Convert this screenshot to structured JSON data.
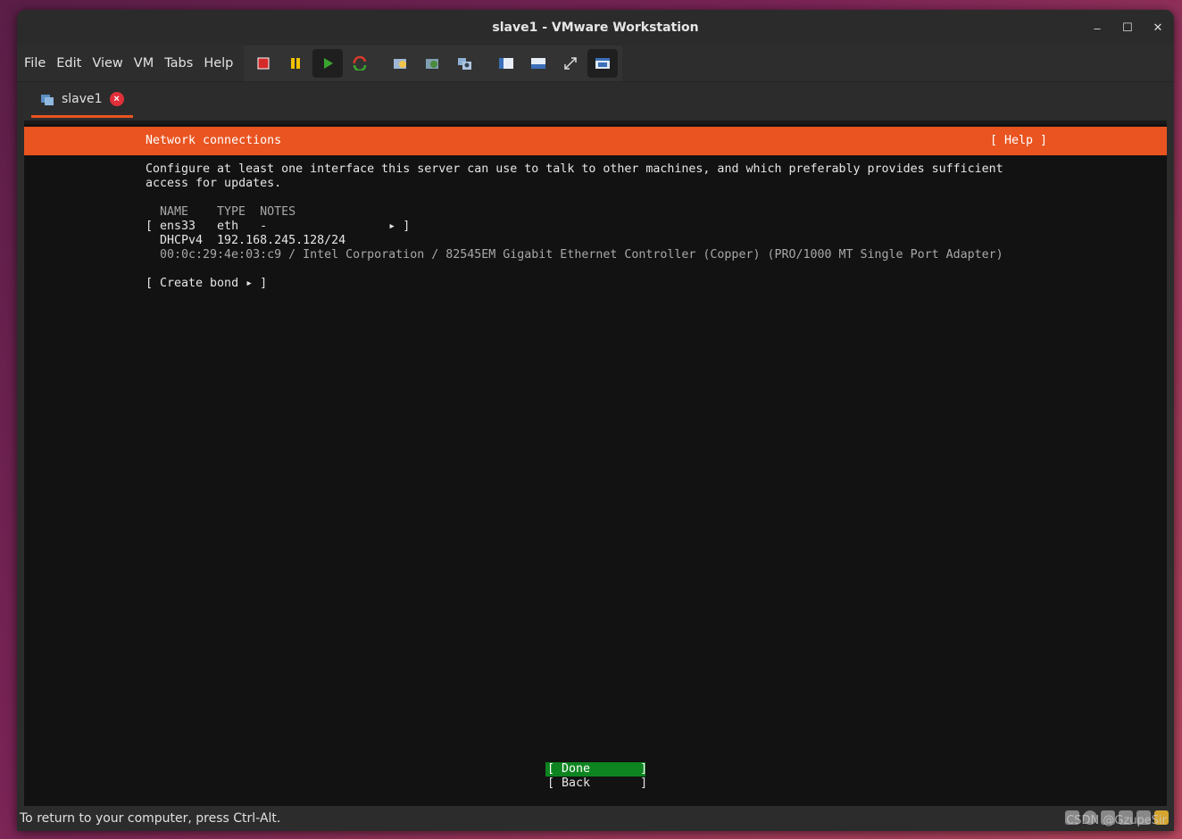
{
  "window": {
    "title": "slave1 - VMware Workstation",
    "controls": [
      "minimize",
      "maximize",
      "close"
    ]
  },
  "menubar": {
    "items": [
      "File",
      "Edit",
      "View",
      "VM",
      "Tabs",
      "Help"
    ]
  },
  "toolbar": {
    "buttons": [
      "power-off-icon",
      "suspend-icon",
      "power-on-icon",
      "reset-icon",
      "snapshot-icon",
      "revert-snapshot-icon",
      "snapshot-manager-icon",
      "show-library-icon",
      "thumbnail-bar-icon",
      "fullscreen-icon",
      "unity-icon"
    ]
  },
  "tab": {
    "label": "slave1"
  },
  "installer": {
    "header_title": "Network connections",
    "header_help": "[ Help ]",
    "desc_line1": "Configure at least one interface this server can use to talk to other machines, and which preferably provides sufficient",
    "desc_line2": "access for updates.",
    "table_header": "NAME    TYPE  NOTES",
    "iface_row": "[ ens33   eth   -                 ▸ ]",
    "dhcp_row": "DHCPv4  192.168.245.128/24",
    "hw_row": "00:0c:29:4e:03:c9 / Intel Corporation / 82545EM Gigabit Ethernet Controller (Copper) (PRO/1000 MT Single Port Adapter)",
    "create_bond": "[ Create bond ▸ ]",
    "done_button": "[ Done       ]",
    "back_button": "[ Back       ]"
  },
  "statusbar": {
    "text": "To return to your computer, press Ctrl-Alt.",
    "watermark": "CSDN @GzupeSir"
  },
  "colors": {
    "accent": "#e95420",
    "done_green": "#0e8420",
    "console_bg": "#121212"
  }
}
